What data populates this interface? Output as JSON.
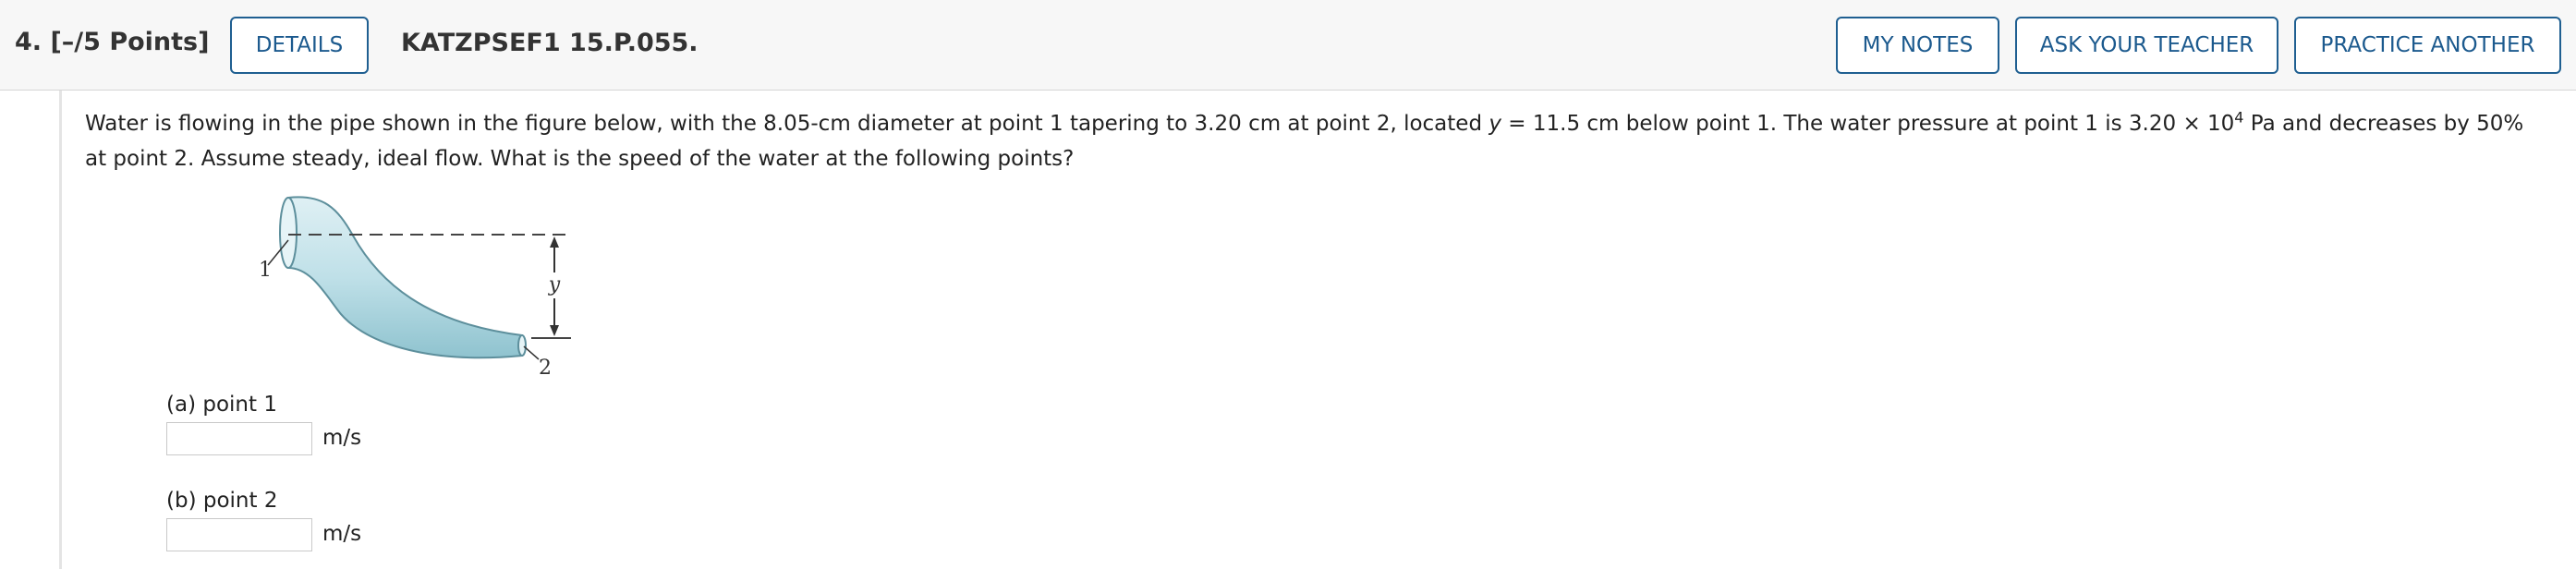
{
  "header": {
    "question_number": "4.  [–/5 Points]",
    "details_label": "DETAILS",
    "problem_code": "KATZPSEF1 15.P.055.",
    "my_notes_label": "MY NOTES",
    "ask_teacher_label": "ASK YOUR TEACHER",
    "practice_label": "PRACTICE ANOTHER"
  },
  "problem": {
    "text_1": "Water is flowing in the pipe shown in the figure below, with the 8.05-cm diameter at point 1 tapering to 3.20 cm at point 2, located ",
    "y_var": "y",
    "text_2": " = 11.5 cm  below point 1. The water pressure at point 1 is 3.20 × 10",
    "exponent": "4",
    "text_3": " Pa and decreases by 50% at point 2. Assume steady, ideal flow. What is the speed of the water at the following points?"
  },
  "figure": {
    "label_point1": "1",
    "label_point2": "2",
    "label_y": "y"
  },
  "parts": [
    {
      "label": "(a) point 1",
      "value": "",
      "unit": "m/s"
    },
    {
      "label": "(b) point 2",
      "value": "",
      "unit": "m/s"
    }
  ]
}
